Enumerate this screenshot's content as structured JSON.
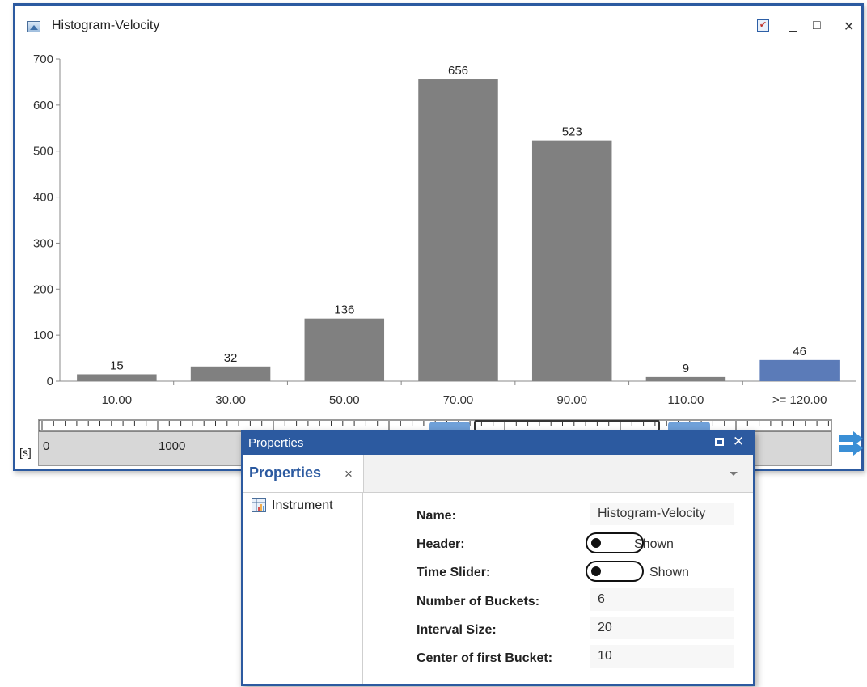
{
  "histogram_window": {
    "title": "Histogram-Velocity",
    "minimize_label": "_",
    "maximize_label": "□",
    "close_label": "✕",
    "badge_label": "✔"
  },
  "chart_data": {
    "type": "bar",
    "categories": [
      "10.00",
      "30.00",
      "50.00",
      "70.00",
      "90.00",
      "110.00",
      ">= 120.00"
    ],
    "values": [
      15,
      32,
      136,
      656,
      523,
      9,
      46
    ],
    "bar_colors": [
      "#808080",
      "#808080",
      "#808080",
      "#808080",
      "#808080",
      "#808080",
      "#5b7bb8"
    ],
    "ylim": [
      0,
      700
    ],
    "yticks": [
      0,
      100,
      200,
      300,
      400,
      500,
      600,
      700
    ],
    "grid": false,
    "legend": "none"
  },
  "time_slider": {
    "unit": "[s]",
    "labels": [
      "0",
      "1000"
    ],
    "next_icon": "arrow-right-icon"
  },
  "properties": {
    "window_title": "Properties",
    "maximize_label": "□",
    "close_label": "✕",
    "tab_label": "Properties",
    "tab_close": "×",
    "tree_item": "Instrument",
    "rows": {
      "name_label": "Name:",
      "name_value": "Histogram-Velocity",
      "header_label": "Header:",
      "header_value": "Shown",
      "time_slider_label": "Time Slider:",
      "time_slider_value": "Shown",
      "buckets_label": "Number of Buckets:",
      "buckets_value": "6",
      "interval_label": "Interval Size:",
      "interval_value": "20",
      "center_label": "Center of first Bucket:",
      "center_value": "10"
    }
  }
}
